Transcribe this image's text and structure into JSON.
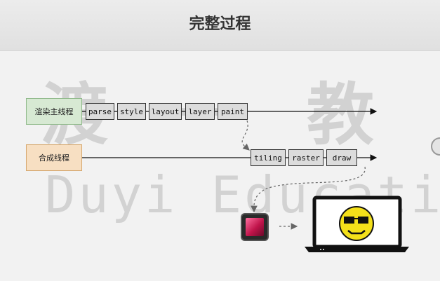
{
  "title": "完整过程",
  "watermark": {
    "chinese": "渡 一 教 育",
    "english": "Duyi Education"
  },
  "threads": {
    "main": "渲染主线程",
    "compositor": "合成线程"
  },
  "main_stages": [
    "parse",
    "style",
    "layout",
    "layer",
    "paint"
  ],
  "compositor_stages": [
    "tiling",
    "raster",
    "draw"
  ],
  "colors": {
    "main_thread_bg": "#d7e9d3",
    "compositor_thread_bg": "#f7dfc2",
    "stage_bg": "#dcdcdc",
    "smiley": "#f4e01a"
  },
  "icons": {
    "gpu": "gpu-chip-icon",
    "display": "laptop-icon",
    "face": "smiley-sunglasses-icon"
  }
}
